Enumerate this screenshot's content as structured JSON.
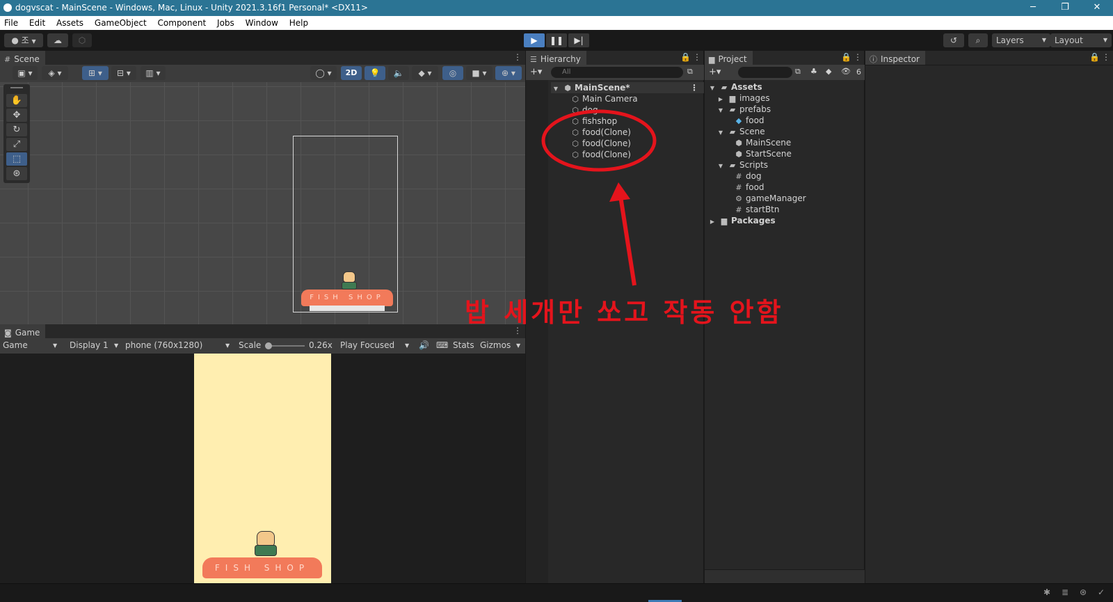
{
  "window": {
    "title": "dogvscat - MainScene - Windows, Mac, Linux - Unity 2021.3.16f1 Personal* <DX11>",
    "minimize": "─",
    "restore": "❐",
    "close": "✕"
  },
  "menu": [
    "File",
    "Edit",
    "Assets",
    "GameObject",
    "Component",
    "Jobs",
    "Window",
    "Help"
  ],
  "toolbar": {
    "account_label": "조",
    "layers_label": "Layers",
    "layout_label": "Layout"
  },
  "scene": {
    "tab_label": "Scene",
    "mode_2d": "2D"
  },
  "game": {
    "tab_label": "Game",
    "view_select": "Game",
    "display_select": "Display 1",
    "resolution_select": "phone (760x1280)",
    "scale_label": "Scale",
    "scale_value": "0.26x",
    "play_focused": "Play Focused",
    "stats_label": "Stats",
    "gizmos_label": "Gizmos",
    "background_color": "#ffeeb0"
  },
  "sprite_text": "FISH SHOP",
  "hierarchy": {
    "tab_label": "Hierarchy",
    "search_placeholder": "All",
    "scene_name": "MainScene*",
    "items": [
      "Main Camera",
      "dog",
      "fishshop",
      "food(Clone)",
      "food(Clone)",
      "food(Clone)"
    ]
  },
  "project": {
    "tab_label": "Project",
    "hidden_count": "6",
    "tree": {
      "assets": "Assets",
      "images": "images",
      "prefabs": "prefabs",
      "prefab_food": "food",
      "scene_folder": "Scene",
      "main_scene": "MainScene",
      "start_scene": "StartScene",
      "scripts": "Scripts",
      "script_dog": "dog",
      "script_food": "food",
      "script_game_manager": "gameManager",
      "script_start_btn": "startBtn",
      "packages": "Packages"
    }
  },
  "inspector": {
    "tab_label": "Inspector"
  },
  "annotation": {
    "text": "밥 세개만 쏘고 작동  안함",
    "color": "#e4141c"
  }
}
